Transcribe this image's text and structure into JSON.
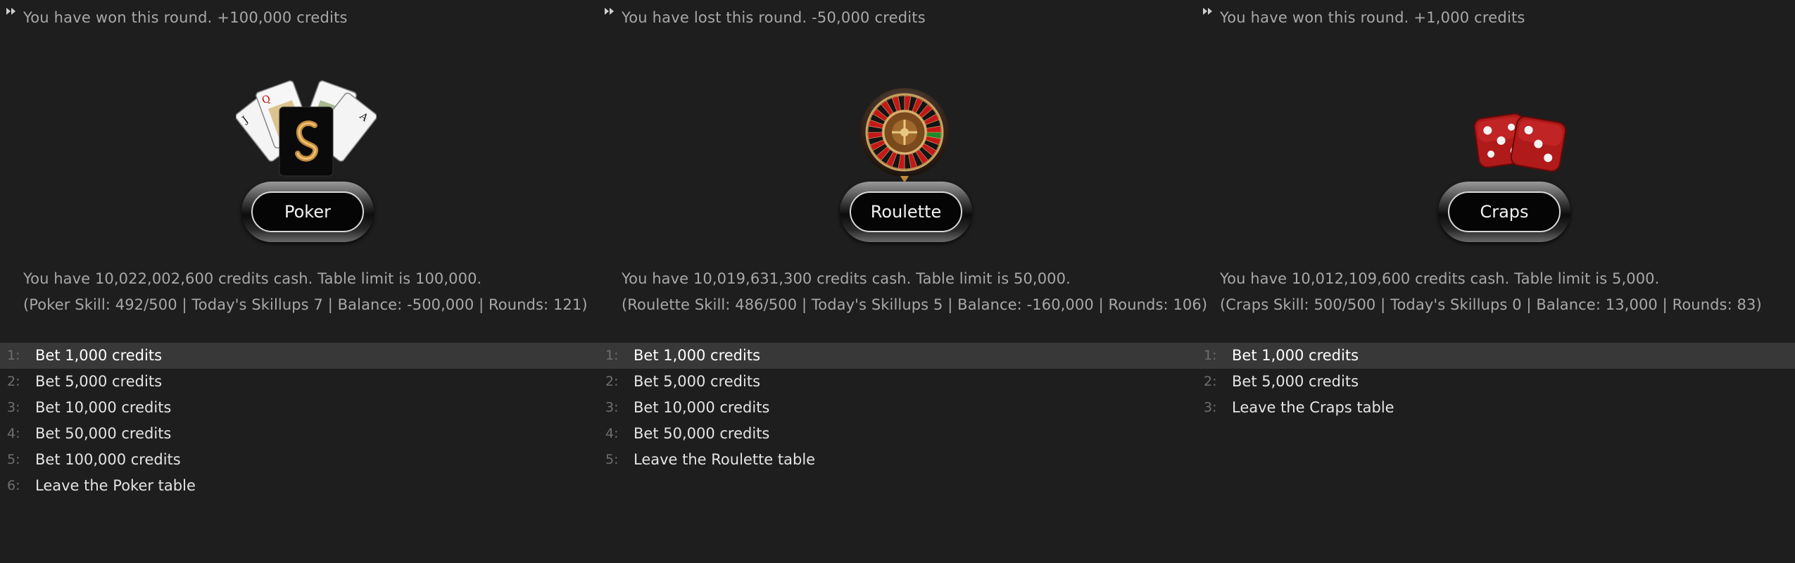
{
  "panels": [
    {
      "log_text": "You have won this round. +100,000 credits",
      "game_label": "Poker",
      "art_icon": "poker-cards-icon",
      "info_cash": "You have 10,022,002,600 credits cash. Table limit is 100,000.",
      "info_stats": "(Poker Skill: 492/500 | Today's Skillups 7 | Balance: -500,000 | Rounds: 121)",
      "menu": [
        {
          "num": "1:",
          "label": "Bet 1,000 credits"
        },
        {
          "num": "2:",
          "label": "Bet 5,000 credits"
        },
        {
          "num": "3:",
          "label": "Bet 10,000 credits"
        },
        {
          "num": "4:",
          "label": "Bet 50,000 credits"
        },
        {
          "num": "5:",
          "label": "Bet 100,000 credits"
        },
        {
          "num": "6:",
          "label": "Leave the Poker table"
        }
      ]
    },
    {
      "log_text": "You have lost this round. -50,000 credits",
      "game_label": "Roulette",
      "art_icon": "roulette-wheel-icon",
      "info_cash": "You have 10,019,631,300 credits cash. Table limit is 50,000.",
      "info_stats": "(Roulette Skill: 486/500 | Today's Skillups 5 | Balance: -160,000 | Rounds: 106)",
      "menu": [
        {
          "num": "1:",
          "label": "Bet 1,000 credits"
        },
        {
          "num": "2:",
          "label": "Bet 5,000 credits"
        },
        {
          "num": "3:",
          "label": "Bet 10,000 credits"
        },
        {
          "num": "4:",
          "label": "Bet 50,000 credits"
        },
        {
          "num": "5:",
          "label": "Leave the Roulette table"
        }
      ]
    },
    {
      "log_text": "You have won this round. +1,000 credits",
      "game_label": "Craps",
      "art_icon": "dice-icon",
      "info_cash": "You have 10,012,109,600 credits cash. Table limit is 5,000.",
      "info_stats": "(Craps Skill: 500/500 | Today's Skillups 0 | Balance: 13,000 | Rounds: 83)",
      "menu": [
        {
          "num": "1:",
          "label": "Bet 1,000 credits"
        },
        {
          "num": "2:",
          "label": "Bet 5,000 credits"
        },
        {
          "num": "3:",
          "label": "Leave the Craps table"
        }
      ]
    }
  ],
  "selected_index": 0,
  "colors": {
    "background": "#1e1e1e",
    "selected_row": "#383838",
    "text_muted": "#a8a8a8",
    "text_bright": "#e4e4e4"
  }
}
